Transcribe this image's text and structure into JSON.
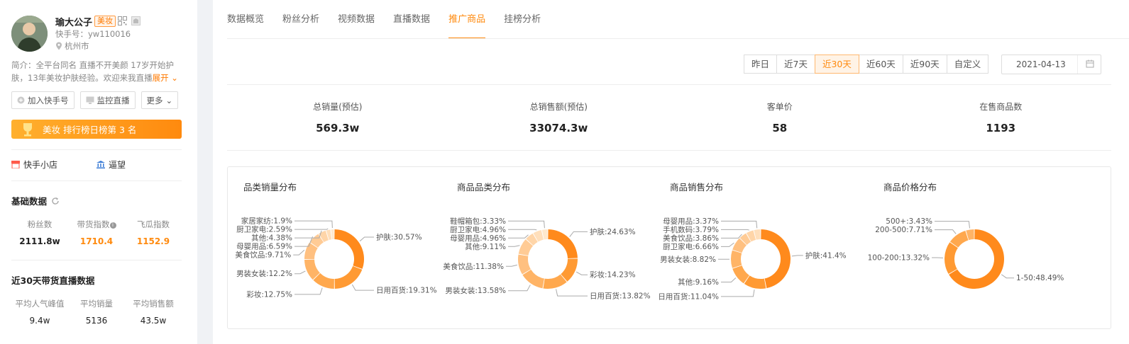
{
  "profile": {
    "name": "瑜大公子",
    "tag": "美妆",
    "account": "快手号：yw110016",
    "city": "杭州市",
    "bio_line1": "简介：全平台同名 直播不开美颜 17岁开始护",
    "bio_line2": "肤，13年美妆护肤经验。欢迎来我直播",
    "bio_expand": "展开"
  },
  "actions": {
    "follow": "加入快手号",
    "monitor": "监控直播",
    "more": "更多"
  },
  "rank": {
    "text": "美妆 排行榜日榜第 3 名"
  },
  "links": {
    "shop": "快手小店",
    "store": "逼望"
  },
  "basic": {
    "title": "基础数据",
    "items": [
      {
        "label": "粉丝数",
        "value": "2111.8w"
      },
      {
        "label": "带货指数",
        "value": "1710.4"
      },
      {
        "label": "飞瓜指数",
        "value": "1152.9"
      }
    ]
  },
  "live30": {
    "title": "近30天带货直播数据",
    "items": [
      {
        "label": "平均人气峰值",
        "value": "9.4w"
      },
      {
        "label": "平均销量",
        "value": "5136"
      },
      {
        "label": "平均销售额",
        "value": "43.5w"
      }
    ]
  },
  "tabs": [
    "数据概览",
    "粉丝分析",
    "视频数据",
    "直播数据",
    "推广商品",
    "挂榜分析"
  ],
  "active_tab": 4,
  "ranges": [
    "昨日",
    "近7天",
    "近30天",
    "近60天",
    "近90天",
    "自定义"
  ],
  "active_range": 2,
  "date": "2021-04-13",
  "kpis": [
    {
      "label": "总销量(预估)",
      "value": "569.3w"
    },
    {
      "label": "总销售额(预估)",
      "value": "33074.3w"
    },
    {
      "label": "客单价",
      "value": "58"
    },
    {
      "label": "在售商品数",
      "value": "1193"
    }
  ],
  "colors": {
    "accent": "#ff8a0e"
  },
  "chart_data": [
    {
      "type": "pie",
      "title": "品类销量分布",
      "slices": [
        {
          "label": "护肤",
          "value": 30.57
        },
        {
          "label": "日用百货",
          "value": 19.31
        },
        {
          "label": "彩妆",
          "value": 12.75
        },
        {
          "label": "男装女装",
          "value": 12.2
        },
        {
          "label": "美食饮品",
          "value": 9.71
        },
        {
          "label": "母婴用品",
          "value": 6.59
        },
        {
          "label": "其他",
          "value": 4.38
        },
        {
          "label": "厨卫家电",
          "value": 2.59
        },
        {
          "label": "家居家纺",
          "value": 1.9
        }
      ]
    },
    {
      "type": "pie",
      "title": "商品品类分布",
      "slices": [
        {
          "label": "护肤",
          "value": 24.63
        },
        {
          "label": "彩妆",
          "value": 14.23
        },
        {
          "label": "日用百货",
          "value": 13.82
        },
        {
          "label": "男装女装",
          "value": 13.58
        },
        {
          "label": "美食饮品",
          "value": 11.38
        },
        {
          "label": "其他",
          "value": 9.11
        },
        {
          "label": "母婴用品",
          "value": 4.96
        },
        {
          "label": "厨卫家电",
          "value": 4.96
        },
        {
          "label": "鞋帽箱包",
          "value": 3.33
        }
      ]
    },
    {
      "type": "pie",
      "title": "商品销售分布",
      "slices": [
        {
          "label": "护肤",
          "value": 41.4
        },
        {
          "label": "日用百货",
          "value": 11.04
        },
        {
          "label": "其他",
          "value": 9.16
        },
        {
          "label": "男装女装",
          "value": 8.82
        },
        {
          "label": "厨卫家电",
          "value": 6.66
        },
        {
          "label": "美食饮品",
          "value": 3.86
        },
        {
          "label": "手机数码",
          "value": 3.79
        },
        {
          "label": "母婴用品",
          "value": 3.37
        }
      ]
    },
    {
      "type": "pie",
      "title": "商品价格分布",
      "slices": [
        {
          "label": "1-50",
          "value": 48.49
        },
        {
          "label": "100-200",
          "value": 13.32
        },
        {
          "label": "200-500",
          "value": 7.71
        },
        {
          "label": "500+",
          "value": 3.43
        }
      ]
    }
  ]
}
